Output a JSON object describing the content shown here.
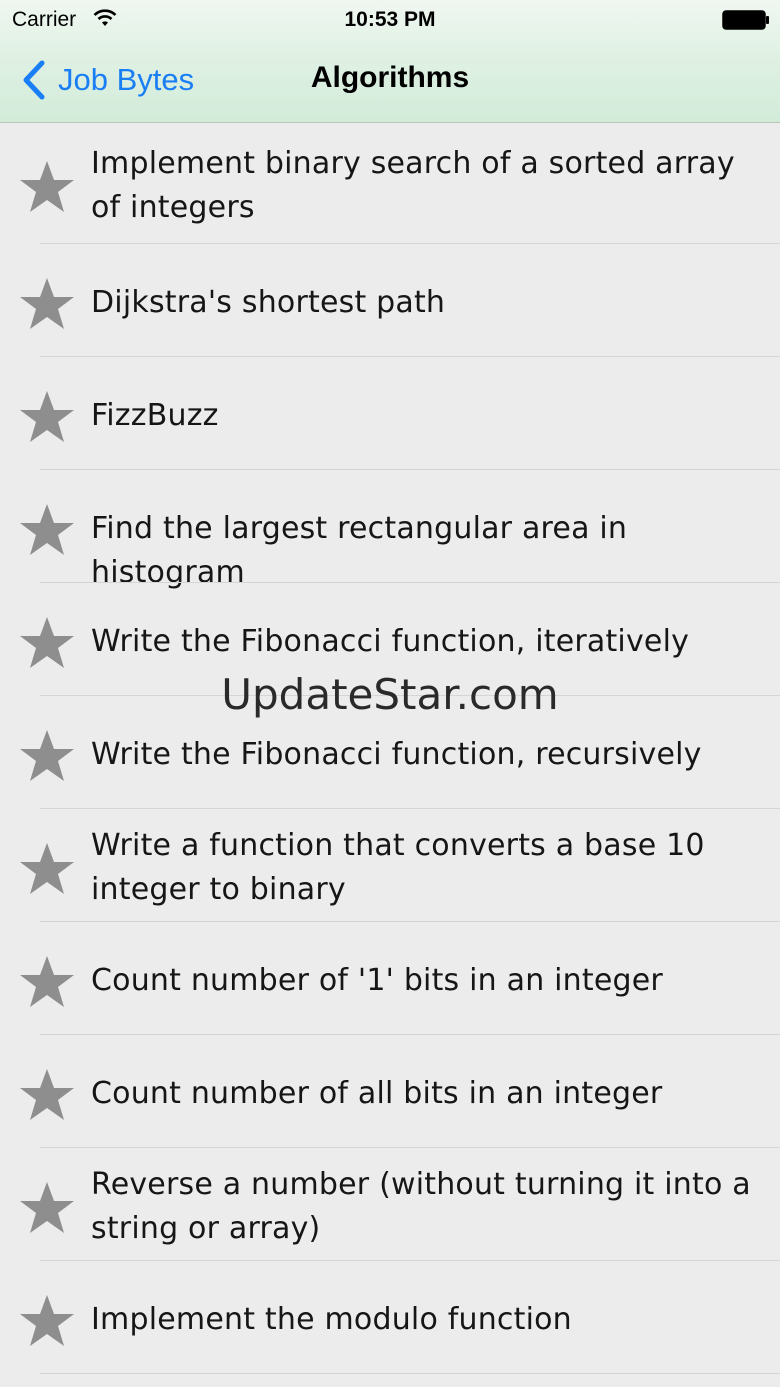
{
  "status_bar": {
    "carrier": "Carrier",
    "time": "10:53 PM",
    "wifi_icon": "wifi-icon",
    "battery_icon": "battery-icon"
  },
  "nav_bar": {
    "back_label": "Job Bytes",
    "back_icon": "chevron-left-icon",
    "title": "Algorithms",
    "accent_color": "#1a7ef5"
  },
  "list": {
    "row_icon": "star-icon",
    "star_color": "#8e8e8e",
    "items": [
      {
        "label": "Implement binary search of a sorted array of integers"
      },
      {
        "label": "Dijkstra's shortest path"
      },
      {
        "label": "FizzBuzz"
      },
      {
        "label": "Find the largest rectangular area in histogram"
      },
      {
        "label": "Write the Fibonacci function, iteratively"
      },
      {
        "label": "Write the Fibonacci function, recursively"
      },
      {
        "label": "Write a function that converts a base 10 integer to binary"
      },
      {
        "label": "Count number of '1' bits in an integer"
      },
      {
        "label": "Count number of all bits in an integer"
      },
      {
        "label": "Reverse a number (without turning it into a string or array)"
      },
      {
        "label": "Implement the modulo function"
      }
    ]
  },
  "watermark": "UpdateStar.com"
}
